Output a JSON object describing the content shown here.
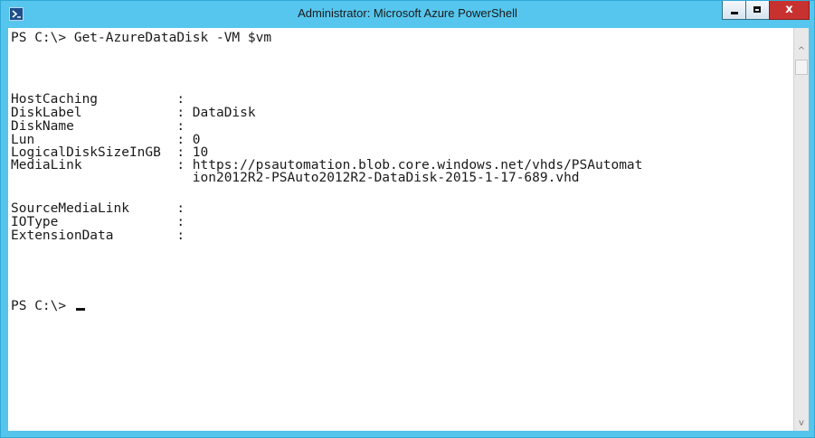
{
  "window": {
    "title": "Administrator: Microsoft Azure PowerShell",
    "icon": "powershell-icon",
    "accent_color": "#55c5ec",
    "close_color": "#c7312f",
    "controls": {
      "minimize_icon": "minimize-icon",
      "maximize_icon": "maximize-icon",
      "close_glyph": "x"
    }
  },
  "console": {
    "lines": [
      "PS C:\\> Get-AzureDataDisk -VM $vm",
      "",
      "",
      "HostCaching          :",
      "DiskLabel            : DataDisk",
      "DiskName             :",
      "Lun                  : 0",
      "LogicalDiskSizeInGB  : 10",
      "MediaLink            : https://psautomation.blob.core.windows.net/vhds/PSAutomat",
      "                       ion2012R2-PSAuto2012R2-DataDisk-2015-1-17-689.vhd",
      "SourceMediaLink      :",
      "IOType               :",
      "ExtensionData        :",
      "",
      "",
      "",
      "",
      "PS C:\\> "
    ],
    "background_color": "#ffffff",
    "text_color": "#1a1a1a"
  },
  "scrollbar": {
    "up_arrow": "^",
    "down_arrow": "v"
  }
}
